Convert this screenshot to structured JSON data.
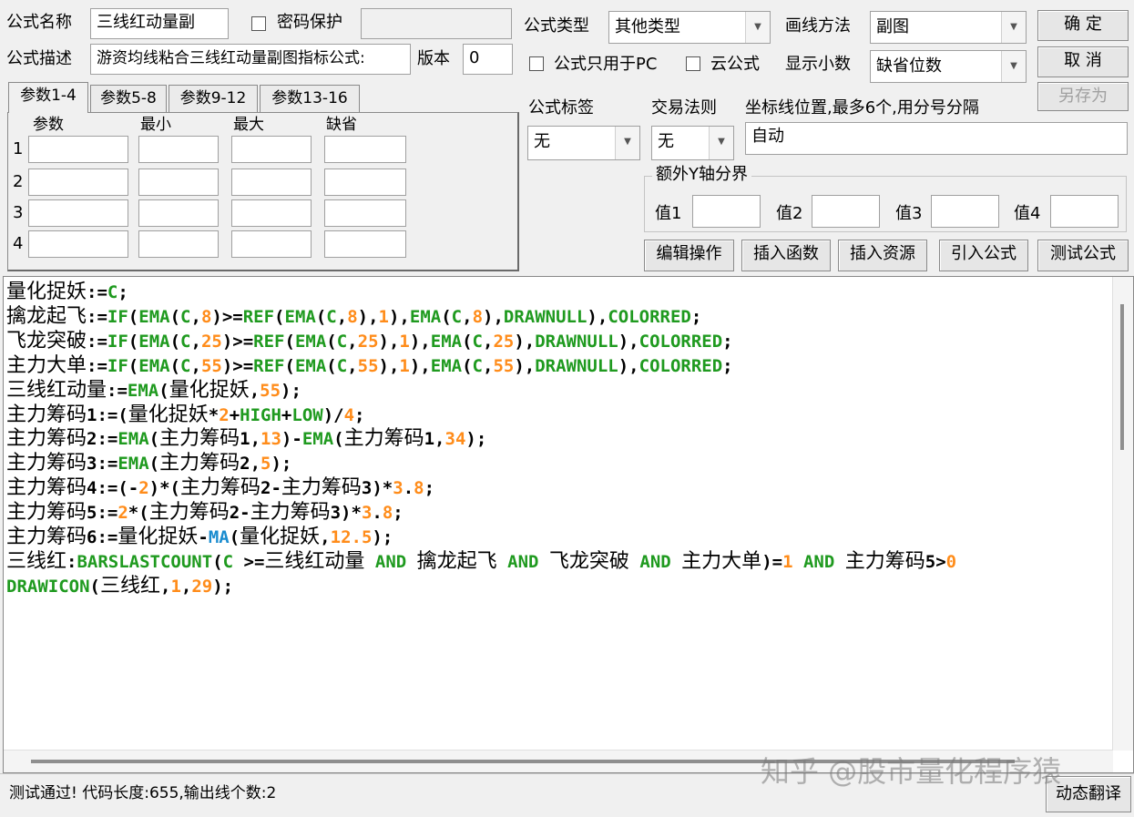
{
  "form": {
    "name_label": "公式名称",
    "name_value": "三线红动量副",
    "password_label": "密码保护",
    "desc_label": "公式描述",
    "desc_value": "游资均线粘合三线红动量副图指标公式:",
    "version_label": "版本",
    "version_value": "0",
    "type_label": "公式类型",
    "type_value": "其他类型",
    "draw_label": "画线方法",
    "draw_value": "副图",
    "pc_only_label": "公式只用于PC",
    "cloud_label": "云公式",
    "decimals_label": "显示小数",
    "decimals_value": "缺省位数",
    "tag_label": "公式标签",
    "tag_value": "无",
    "trade_label": "交易法则",
    "trade_value": "无",
    "coord_label": "坐标线位置,最多6个,用分号分隔",
    "coord_value": "自动",
    "yaxis_group_label": "额外Y轴分界",
    "yaxis_values": [
      "值1",
      "值2",
      "值3",
      "值4"
    ]
  },
  "buttons": {
    "ok": "确 定",
    "cancel": "取 消",
    "save_as": "另存为",
    "edit_ops": "编辑操作",
    "insert_func": "插入函数",
    "insert_res": "插入资源",
    "import_formula": "引入公式",
    "test_formula": "测试公式",
    "dynamic_translate": "动态翻译"
  },
  "params": {
    "tabs": [
      "参数1-4",
      "参数5-8",
      "参数9-12",
      "参数13-16"
    ],
    "columns": [
      "参数",
      "最小",
      "最大",
      "缺省"
    ],
    "rows": [
      "1",
      "2",
      "3",
      "4"
    ]
  },
  "status": {
    "text": "测试通过! 代码长度:655,输出线个数:2"
  },
  "watermark": "知乎 @股市量化程序猿"
}
